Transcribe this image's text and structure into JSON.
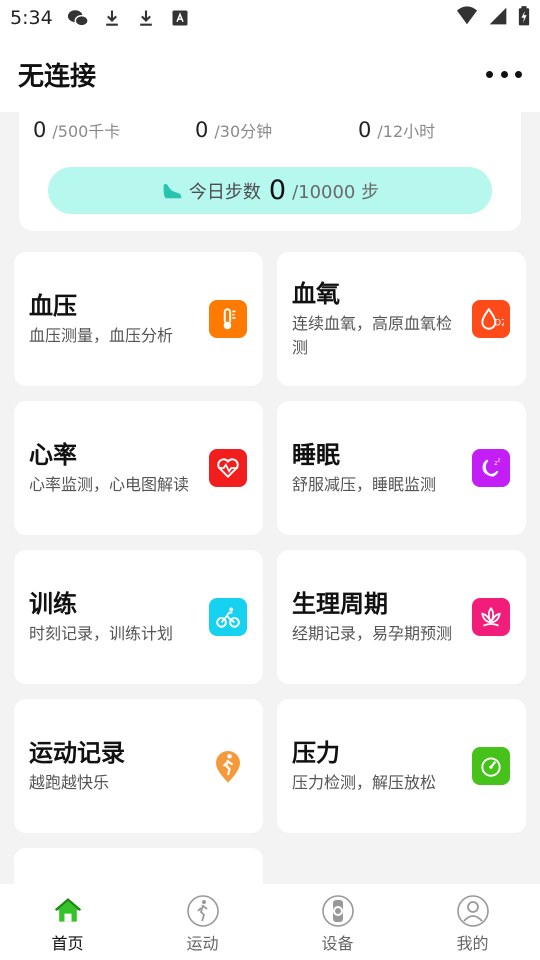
{
  "status_bar": {
    "time": "5:34"
  },
  "header": {
    "title": "无连接"
  },
  "summary": {
    "calories": {
      "value": "0",
      "goal": "/500千卡"
    },
    "minutes": {
      "value": "0",
      "goal": "/30分钟"
    },
    "hours": {
      "value": "0",
      "goal": "/12小时"
    },
    "steps": {
      "label": "今日步数",
      "value": "0",
      "goal": "/10000 步"
    }
  },
  "cards": [
    {
      "name": "血压",
      "desc": "血压测量，血压分析",
      "icon": "thermometer-icon",
      "color": "#ff7a00"
    },
    {
      "name": "血氧",
      "desc": "连续血氧，高原血氧检测",
      "icon": "oxygen-drop-icon",
      "color": "#ff4a1a"
    },
    {
      "name": "心率",
      "desc": "心率监测，心电图解读",
      "icon": "heart-rate-icon",
      "color": "#f21d1d"
    },
    {
      "name": "睡眠",
      "desc": "舒服减压，睡眠监测",
      "icon": "moon-icon",
      "color": "#c21ef5"
    },
    {
      "name": "训练",
      "desc": "时刻记录，训练计划",
      "icon": "cycling-icon",
      "color": "#16d1f0"
    },
    {
      "name": "生理周期",
      "desc": "经期记录，易孕期预测",
      "icon": "lotus-icon",
      "color": "#f21d7a"
    },
    {
      "name": "运动记录",
      "desc": "越跑越快乐",
      "icon": "runner-pin-icon",
      "color": "#f59a3a"
    },
    {
      "name": "压力",
      "desc": "压力检测，解压放松",
      "icon": "gauge-icon",
      "color": "#46c21a"
    }
  ],
  "bottom_nav": [
    {
      "label": "首页",
      "icon": "home-icon",
      "active": true
    },
    {
      "label": "运动",
      "icon": "exercise-icon",
      "active": false
    },
    {
      "label": "设备",
      "icon": "watch-icon",
      "active": false
    },
    {
      "label": "我的",
      "icon": "profile-icon",
      "active": false
    }
  ],
  "colors": {
    "accent": "#36c22a",
    "steps_pill": "#b6f7ee",
    "background": "#f3f3f3"
  }
}
